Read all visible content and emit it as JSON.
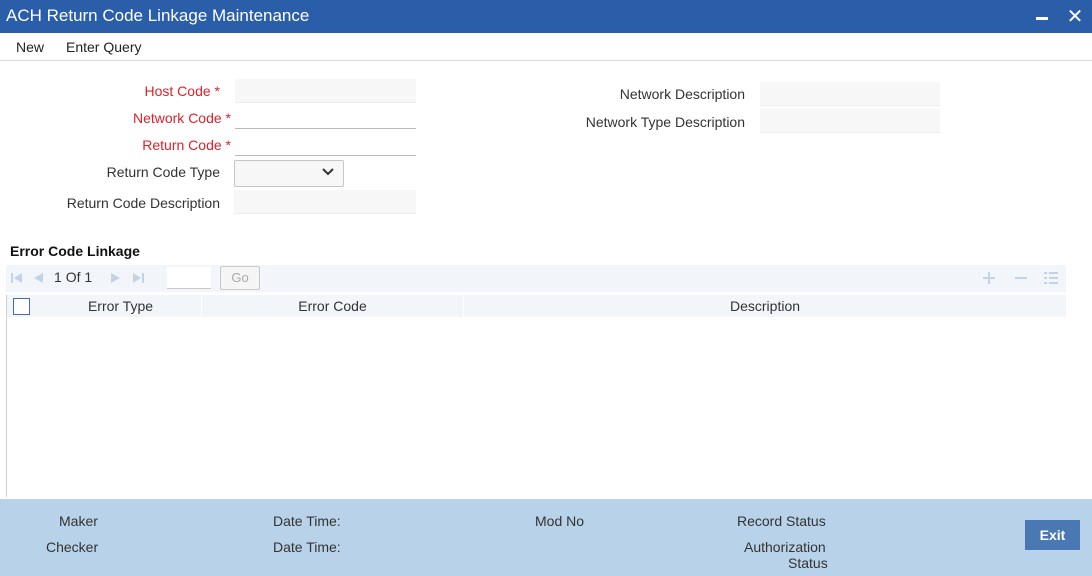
{
  "window": {
    "title": "ACH Return Code Linkage Maintenance"
  },
  "menu": {
    "new_label": "New",
    "enter_query_label": "Enter Query"
  },
  "form": {
    "host_code": {
      "label": "Host Code",
      "required_mark": "*",
      "value": ""
    },
    "network_code": {
      "label": "Network Code",
      "required_mark": "*",
      "value": ""
    },
    "return_code": {
      "label": "Return Code",
      "required_mark": "*",
      "value": ""
    },
    "return_code_type": {
      "label": "Return Code Type",
      "value": ""
    },
    "return_code_description": {
      "label": "Return Code Description",
      "value": ""
    },
    "network_description": {
      "label": "Network Description",
      "value": ""
    },
    "network_type_description": {
      "label": "Network Type Description",
      "value": ""
    }
  },
  "error_code_linkage": {
    "title": "Error Code Linkage",
    "pager": {
      "current": "1",
      "of_label": "Of",
      "total": "1",
      "go_label": "Go"
    },
    "columns": [
      "Error Type",
      "Error Code",
      "Description"
    ],
    "rows": []
  },
  "footer": {
    "maker_label": "Maker",
    "checker_label": "Checker",
    "date_time_label": "Date Time:",
    "mod_no_label": "Mod No",
    "record_status_label": "Record Status",
    "authorization_label": "Authorization",
    "status_label": "Status",
    "exit_label": "Exit"
  },
  "colors": {
    "titlebar": "#2a5ea8",
    "required": "#e0202a",
    "footer": "#b8d2ea",
    "exit_button": "#4a78b2"
  },
  "icons": [
    "minimize-icon",
    "close-icon",
    "chevron-down-icon",
    "first-page-icon",
    "previous-page-icon",
    "next-page-icon",
    "last-page-icon",
    "add-row-icon",
    "delete-row-icon",
    "single-view-icon"
  ]
}
